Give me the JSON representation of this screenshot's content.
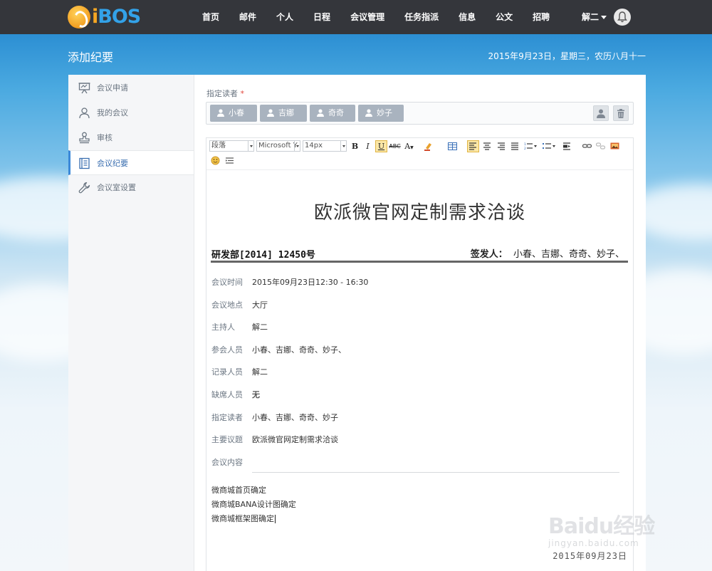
{
  "header": {
    "logo_text_i": "i",
    "logo_text_rest": "BOS",
    "nav": [
      "首页",
      "邮件",
      "个人",
      "日程",
      "会议管理",
      "任务指派",
      "信息",
      "公文",
      "招聘"
    ],
    "user": "解二"
  },
  "page": {
    "title": "添加纪要",
    "date": "2015年9月23日，星期三，农历八月十一"
  },
  "sidebar": {
    "items": [
      {
        "label": "会议申请",
        "icon": "presentation-icon"
      },
      {
        "label": "我的会议",
        "icon": "user-icon"
      },
      {
        "label": "审核",
        "icon": "stamp-icon"
      },
      {
        "label": "会议纪要",
        "icon": "notebook-icon"
      },
      {
        "label": "会议室设置",
        "icon": "wrench-icon"
      }
    ],
    "active_index": 3
  },
  "readers": {
    "label": "指定读者",
    "required_mark": "*",
    "chips": [
      "小春",
      "吉娜",
      "奇奇",
      "妙子"
    ]
  },
  "toolbar": {
    "paragraph": "段落",
    "font": "Microsoft Y",
    "size": "14px",
    "bold": "B",
    "italic": "I",
    "underline": "U",
    "strike": "ABC",
    "font_color": "A"
  },
  "document": {
    "title": "欧派微官网定制需求洽谈",
    "code": "研发部[2014]  12450号",
    "issuer_label": "签发人：",
    "issuer": "小春、吉娜、奇奇、妙子、",
    "fields": [
      {
        "key": "会议时间",
        "value": "2015年09月23日12:30 - 16:30"
      },
      {
        "key": "会议地点",
        "value": "大厅"
      },
      {
        "key": "主持人",
        "value": "解二"
      },
      {
        "key": "参会人员",
        "value": "小春、吉娜、奇奇、妙子、"
      },
      {
        "key": "记录人员",
        "value": "解二"
      },
      {
        "key": "缺席人员",
        "value": "无"
      },
      {
        "key": "指定读者",
        "value": "小春、吉娜、奇奇、妙子"
      },
      {
        "key": "主要议题",
        "value": "欧派微官网定制需求洽谈"
      }
    ],
    "section_label": "会议内容",
    "body_lines": [
      "微商城首页确定",
      "微商城BANA设计图确定",
      "微商城框架图确定"
    ],
    "footer_date": "2015年09月23日"
  },
  "watermark": {
    "logo": "Baidu经验",
    "sub": "jingyan.baidu.com"
  }
}
